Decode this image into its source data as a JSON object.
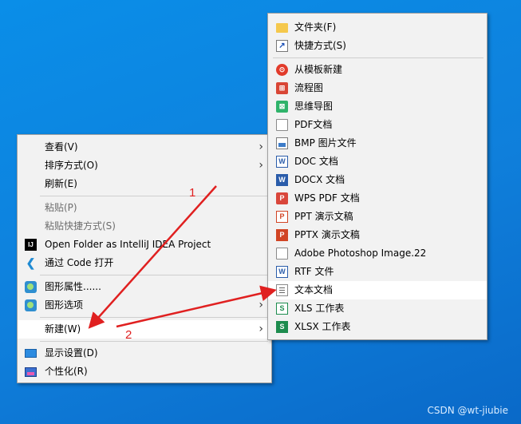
{
  "context_menu": {
    "items": [
      {
        "label": "查看(V)"
      },
      {
        "label": "排序方式(O)"
      },
      {
        "label": "刷新(E)"
      },
      {
        "label": "粘贴(P)"
      },
      {
        "label": "粘贴快捷方式(S)"
      },
      {
        "label": "Open Folder as IntelliJ IDEA Project"
      },
      {
        "label": "通过 Code 打开"
      },
      {
        "label": "图形属性......"
      },
      {
        "label": "图形选项"
      },
      {
        "label": "新建(W)"
      },
      {
        "label": "显示设置(D)"
      },
      {
        "label": "个性化(R)"
      }
    ]
  },
  "new_submenu": {
    "items": [
      {
        "label": "文件夹(F)"
      },
      {
        "label": "快捷方式(S)"
      },
      {
        "label": "从模板新建"
      },
      {
        "label": "流程图"
      },
      {
        "label": "思维导图"
      },
      {
        "label": "PDF文档"
      },
      {
        "label": "BMP 图片文件"
      },
      {
        "label": "DOC 文档"
      },
      {
        "label": "DOCX 文档"
      },
      {
        "label": "WPS PDF 文档"
      },
      {
        "label": "PPT 演示文稿"
      },
      {
        "label": "PPTX 演示文稿"
      },
      {
        "label": "Adobe Photoshop Image.22"
      },
      {
        "label": "RTF 文件"
      },
      {
        "label": "文本文档"
      },
      {
        "label": "XLS 工作表"
      },
      {
        "label": "XLSX 工作表"
      }
    ]
  },
  "annotations": {
    "step1": "1",
    "step2": "2",
    "arrow_color": "#e02020"
  },
  "watermark": "CSDN @wt-jiubie"
}
